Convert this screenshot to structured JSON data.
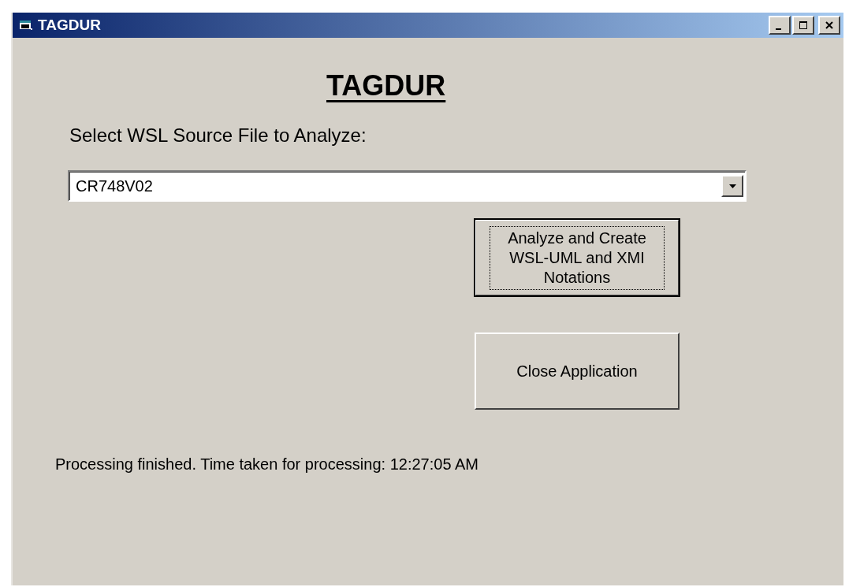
{
  "window": {
    "title": "TAGDUR"
  },
  "heading": "TAGDUR",
  "source_label": "Select WSL Source File to Analyze:",
  "source_select": {
    "value": "CR748V02"
  },
  "buttons": [
    {
      "label": "Analyze and Create WSL-UML and XMI Notations",
      "focused": true
    },
    {
      "label": "Close Application",
      "focused": false
    }
  ],
  "status": "Processing finished. Time taken for processing: 12:27:05 AM"
}
